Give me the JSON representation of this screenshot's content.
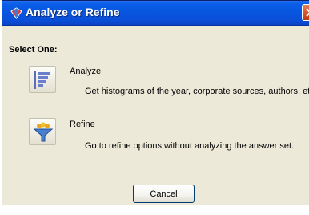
{
  "window": {
    "title": "Analyze or Refine",
    "title_icon": "gem-icon",
    "close_icon": "close-icon"
  },
  "dialog": {
    "prompt": "Select One:",
    "options": [
      {
        "label": "Analyze",
        "description": "Get histograms of the year, corporate sources, authors, etc.",
        "icon": "histogram-icon"
      },
      {
        "label": "Refine",
        "description": "Go to refine options without analyzing the answer set.",
        "icon": "funnel-icon"
      }
    ],
    "cancel_label": "Cancel"
  },
  "colors": {
    "titlebar": "#0a5fe8",
    "dialog_bg": "#ece9d8",
    "close_button": "#d8562e"
  }
}
